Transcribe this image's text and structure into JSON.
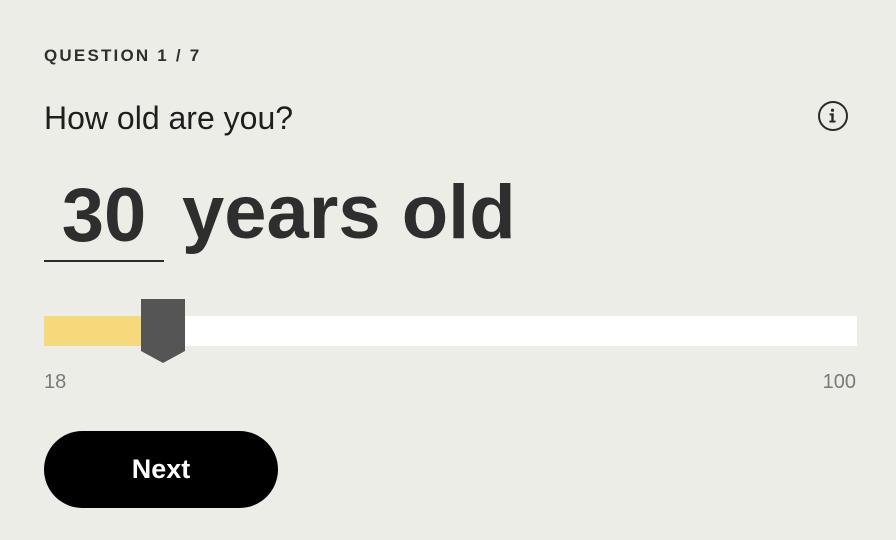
{
  "progress": {
    "label": "QUESTION 1 / 7"
  },
  "question": {
    "text": "How old are you?",
    "info_icon": "info-icon"
  },
  "age": {
    "value": "30",
    "unit": "years old"
  },
  "slider": {
    "min": 18,
    "max": 100,
    "value": 30,
    "min_label": "18",
    "max_label": "100",
    "fill_color": "#f6d97a",
    "track_color": "#ffffff",
    "thumb_color": "#555555"
  },
  "actions": {
    "next_label": "Next"
  },
  "colors": {
    "background": "#ededE7",
    "button": "#000000",
    "text": "#2e2e2e"
  }
}
